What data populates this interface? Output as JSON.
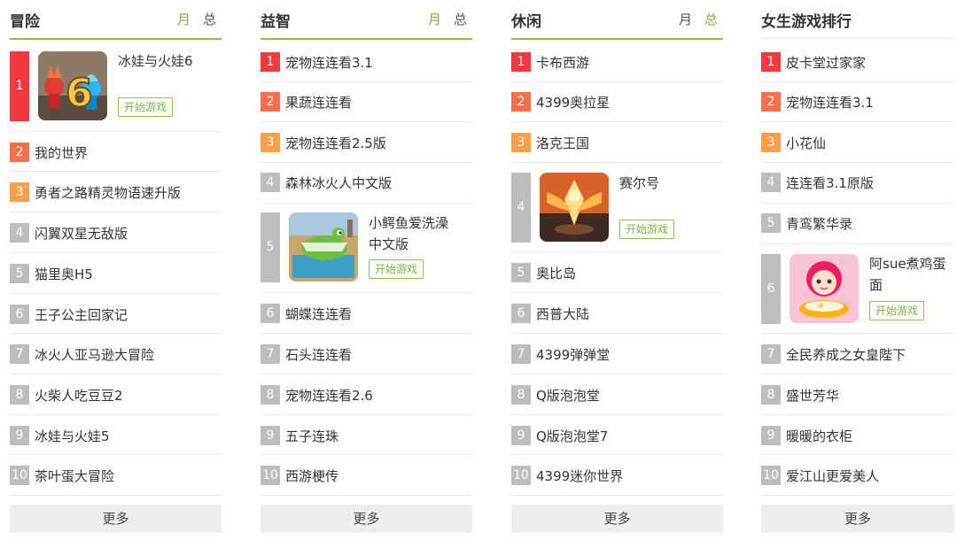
{
  "columns": [
    {
      "title": "冒险",
      "tab_month": "月",
      "tab_total": "总",
      "active_tab": "month",
      "featured_rank": "1",
      "featured_name": "冰娃与火娃6",
      "featured_button": "开始游戏",
      "featured_icon": "fireboy-watergirl-icon",
      "items": [
        "2",
        "我的世界",
        "3",
        "勇者之路精灵物语速升版",
        "4",
        "闪翼双星无敌版",
        "5",
        "猫里奥H5",
        "6",
        "王子公主回家记",
        "7",
        "冰火人亚马逊大冒险",
        "8",
        "火柴人吃豆豆2",
        "9",
        "冰娃与火娃5",
        "10",
        "茶叶蛋大冒险"
      ],
      "more": "更多"
    },
    {
      "title": "益智",
      "tab_month": "月",
      "tab_total": "总",
      "active_tab": "month",
      "top": [
        "1",
        "宠物连连看3.1",
        "2",
        "果蔬连连看",
        "3",
        "宠物连连看2.5版",
        "4",
        "森林冰火人中文版"
      ],
      "featured_rank": "5",
      "featured_name": "小鳄鱼爱洗澡中文版",
      "featured_button": "开始游戏",
      "featured_icon": "crocodile-icon",
      "items": [
        "6",
        "蝴蝶连连看",
        "7",
        "石头连连看",
        "8",
        "宠物连连看2.6",
        "9",
        "五子连珠",
        "10",
        "西游梗传"
      ],
      "more": "更多"
    },
    {
      "title": "休闲",
      "tab_month": "月",
      "tab_total": "总",
      "active_tab": "total",
      "top": [
        "1",
        "卡布西游",
        "2",
        "4399奥拉星",
        "3",
        "洛克王国"
      ],
      "featured_rank": "4",
      "featured_name": "赛尔号",
      "featured_button": "开始游戏",
      "featured_icon": "seer-icon",
      "items": [
        "5",
        "奥比岛",
        "6",
        "西普大陆",
        "7",
        "4399弹弹堂",
        "8",
        "Q版泡泡堂",
        "9",
        "Q版泡泡堂7",
        "10",
        "4399迷你世界"
      ],
      "more": "更多"
    },
    {
      "title": "女生游戏排行",
      "top": [
        "1",
        "皮卡堂过家家",
        "2",
        "宠物连连看3.1",
        "3",
        "小花仙",
        "4",
        "连连看3.1原版",
        "5",
        "青鸾繁华录"
      ],
      "featured_rank": "6",
      "featured_name": "阿sue煮鸡蛋面",
      "featured_button": "开始游戏",
      "featured_icon": "girl-cooking-icon",
      "items": [
        "7",
        "全民养成之女皇陛下",
        "8",
        "盛世芳华",
        "9",
        "暖暖的衣柜",
        "10",
        "爱江山更爱美人"
      ],
      "more": "更多"
    }
  ],
  "colors": {
    "accent_green": "#8bc34a",
    "rank1": "#f2393f",
    "rank2": "#f7704d",
    "rank3": "#f99f4c",
    "rank_other": "#bdbdbd"
  }
}
